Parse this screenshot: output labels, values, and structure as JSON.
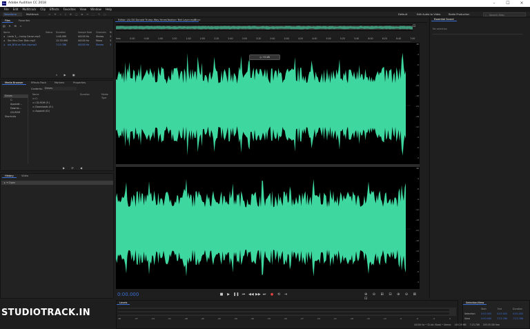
{
  "window": {
    "title": "Adobe Audition CC 2018",
    "logo": "Au"
  },
  "menu": [
    "File",
    "Edit",
    "Multitrack",
    "Clip",
    "Effects",
    "Favorites",
    "View",
    "Window",
    "Help"
  ],
  "toolbar": {
    "waveform": "Waveform",
    "multitrack": "Multitrack",
    "workspace": "Default",
    "edit_video": "Edit Audio to Video",
    "radio": "Radio Production",
    "search_placeholder": "Search Help"
  },
  "files_panel": {
    "tabs": [
      "Files",
      "Favorites"
    ],
    "headers": [
      "Name",
      "Status",
      "Duration",
      "Sample Rate",
      "Channels",
      "Bi"
    ],
    "rows": [
      {
        "name": "Lecto 3_...hoing Canon.mp3",
        "duration": "1:46.490",
        "rate": "44100 Hz",
        "ch": "Stereo",
        "bits": "3"
      },
      {
        "name": "Sec Mrz-Chor Didn.mp3",
        "duration": "12:33.990",
        "rate": "44100 Hz",
        "ch": "Mono",
        "bits": "3"
      },
      {
        "name": "old_BOX.wr Slot Lay.mp3",
        "duration": "7:23.786",
        "rate": "44100 Hz",
        "ch": "Stereo",
        "bits": "3"
      }
    ]
  },
  "media_panel": {
    "tabs": [
      "Media Browser",
      "Effects Rack",
      "Markers",
      "Properties"
    ],
    "contents_label": "Contents:",
    "contents_value": "Drives",
    "tree": [
      "Drives",
      "C:",
      "Apparat...",
      "Downlo...",
      "CD-ROM",
      "Shortcuts"
    ],
    "list_headers": [
      "Name",
      "Duration",
      "Media Type"
    ],
    "list": [
      "C:",
      "CD-ROM (F:)",
      "Downloads (E:)",
      "Apparat (D:)"
    ]
  },
  "history_panel": {
    "tabs": [
      "History",
      "Video"
    ],
    "items": [
      "Open"
    ]
  },
  "editor": {
    "tabs": [
      "Editor: (A) DS Donald Trump Way Hmm(fashion 'Bet Layer.mp3",
      "Mixer"
    ],
    "hud_value": "+0 dB",
    "ruler": [
      "hms",
      "0:20",
      "0:40",
      "1:00",
      "1:20",
      "1:40",
      "2:00",
      "2:20",
      "2:40",
      "3:00",
      "3:20",
      "3:40",
      "4:00",
      "4:20",
      "4:40",
      "5:00",
      "5:20",
      "5:40",
      "6:00",
      "6:20",
      "6:40",
      "7:00"
    ],
    "db_top": [
      "dB",
      "-3",
      "-6",
      "-9",
      "-12",
      "-18",
      "-21",
      "-18",
      "-12",
      "-9",
      "-6",
      "-3"
    ],
    "db_bottom": [
      "dB",
      "-3",
      "-6",
      "-9",
      "-12",
      "-18",
      "-21",
      "-18",
      "-12",
      "-9",
      "-6",
      "-3"
    ],
    "time_display": "0:00.000"
  },
  "right_panel": {
    "title": "Essential Sound",
    "sub": "No selection"
  },
  "levels": {
    "title": "Levels",
    "scale": [
      "dB",
      "-57",
      "-54",
      "-51",
      "-48",
      "-45",
      "-42",
      "-39",
      "-36",
      "-33",
      "-30",
      "-27",
      "-24",
      "-21",
      "-18",
      "-15",
      "-12",
      "-9",
      "-6",
      "-3",
      "0"
    ]
  },
  "selection_view": {
    "title": "Selection/View",
    "headers": [
      "Start",
      "End",
      "Duration"
    ],
    "rows": [
      {
        "label": "Selection",
        "start": "0:00.000",
        "end": "0:00.000",
        "dur": "0:00.000"
      },
      {
        "label": "View",
        "start": "0:00.000",
        "end": "7:23.786",
        "dur": "7:23.786"
      }
    ]
  },
  "status": {
    "format": "44100 Hz • 32-bit (float) • Stereo",
    "size": "149.29 MB",
    "dur": "7:23.786",
    "free": "203.55 GB free"
  },
  "watermark": "STUDIOTRACK.IN",
  "colors": {
    "waveform": "#3fd7a0",
    "accent": "#3b6fd6",
    "time": "#3b6fd6"
  }
}
